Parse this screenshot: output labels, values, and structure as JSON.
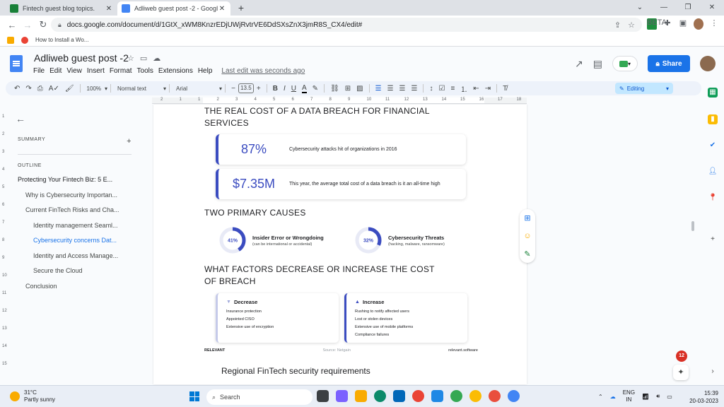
{
  "browser": {
    "tabs": [
      {
        "label": "Fintech guest blog topics.",
        "close": "✕",
        "color": "#188038"
      },
      {
        "label": "Adliweb guest post -2 - Google D",
        "close": "✕",
        "color": "#4285f4"
      }
    ],
    "new_tab": "+",
    "url": "docs.google.com/document/d/1GtX_xWM8KnzrEDjUWjRvtrVE6DdSXsZnX3jmR8S_CX4/edit#",
    "bookmark": "How to Install a Wo...",
    "beta_label": "BETA"
  },
  "docs": {
    "title": "Adliweb guest post -2",
    "menu": [
      "File",
      "Edit",
      "View",
      "Insert",
      "Format",
      "Tools",
      "Extensions",
      "Help"
    ],
    "last_edit": "Last edit was seconds ago",
    "share_label": "Share",
    "toolbar": {
      "zoom": "100%",
      "style": "Normal text",
      "font": "Arial",
      "font_size": "13.5",
      "mode": "Editing"
    }
  },
  "outline": {
    "summary_label": "SUMMARY",
    "outline_label": "OUTLINE",
    "add": "+",
    "items": [
      {
        "label": "Protecting Your Fintech Biz: 5 E...",
        "level": 1
      },
      {
        "label": "Why is Cybersecurity Importan...",
        "level": 2
      },
      {
        "label": "Current FinTech Risks and Cha...",
        "level": 2
      },
      {
        "label": "Identity management Seaml...",
        "level": 3
      },
      {
        "label": "Cybersecurity concerns Dat...",
        "level": 3,
        "active": true
      },
      {
        "label": "Identity and Access Manage...",
        "level": 3
      },
      {
        "label": "Secure the Cloud",
        "level": 3
      },
      {
        "label": "Conclusion",
        "level": 2
      }
    ]
  },
  "page": {
    "heading1": "THE REAL COST OF A DATA BREACH FOR FINANCIAL SERVICES",
    "stats": [
      {
        "value": "87%",
        "desc": "Cybersecurity attacks hit of organizations in 2016"
      },
      {
        "value": "$7.35M",
        "desc": "This year, the average total cost of a data breach is it an all-time high"
      }
    ],
    "heading2": "TWO PRIMARY CAUSES",
    "causes": [
      {
        "percent": "41%",
        "fraction": 0.41,
        "title": "Insider Error or Wrongdoing",
        "sub": "(can be international or accidental)"
      },
      {
        "percent": "32%",
        "fraction": 0.32,
        "title": "Cybersecurity Threats",
        "sub": "(hacking, malware, ransomware)"
      }
    ],
    "heading3": "WHAT FACTORS DECREASE OR INCREASE THE COST OF BREACH",
    "decrease": {
      "title": "Decrease",
      "items": [
        "Insurance protection",
        "Appointed CISO",
        "Extensive use of encryption"
      ]
    },
    "increase": {
      "title": "Increase",
      "items": [
        "Rushing to notify affected users",
        "Lost or stolen devices",
        "Extensive use of mobile platforms",
        "Compliance failures"
      ]
    },
    "footer_left": "RELEVANT",
    "footer_source": "Source: Netgain",
    "footer_right": "relevant.software",
    "next_heading": "Regional FinTech security requirements"
  },
  "ruler": {
    "numbers": [
      "2",
      "1",
      "1",
      "2",
      "3",
      "4",
      "5",
      "6",
      "7",
      "8",
      "9",
      "10",
      "11",
      "12",
      "13",
      "14",
      "15",
      "16",
      "17",
      "18"
    ],
    "vertical_numbers": [
      "1",
      "2",
      "3",
      "4",
      "5",
      "6",
      "7",
      "8",
      "9",
      "10",
      "11",
      "12",
      "13",
      "14",
      "15"
    ]
  },
  "side_badge": "12",
  "taskbar": {
    "temperature": "31°C",
    "weather": "Partly sunny",
    "search_placeholder": "Search",
    "lang": "ENG",
    "region": "IN",
    "time": "15:39",
    "date": "20-03-2023"
  },
  "colors": {
    "accent": "#3b4cc0",
    "share": "#1a73e8",
    "active_outline": "#1a73e8"
  }
}
